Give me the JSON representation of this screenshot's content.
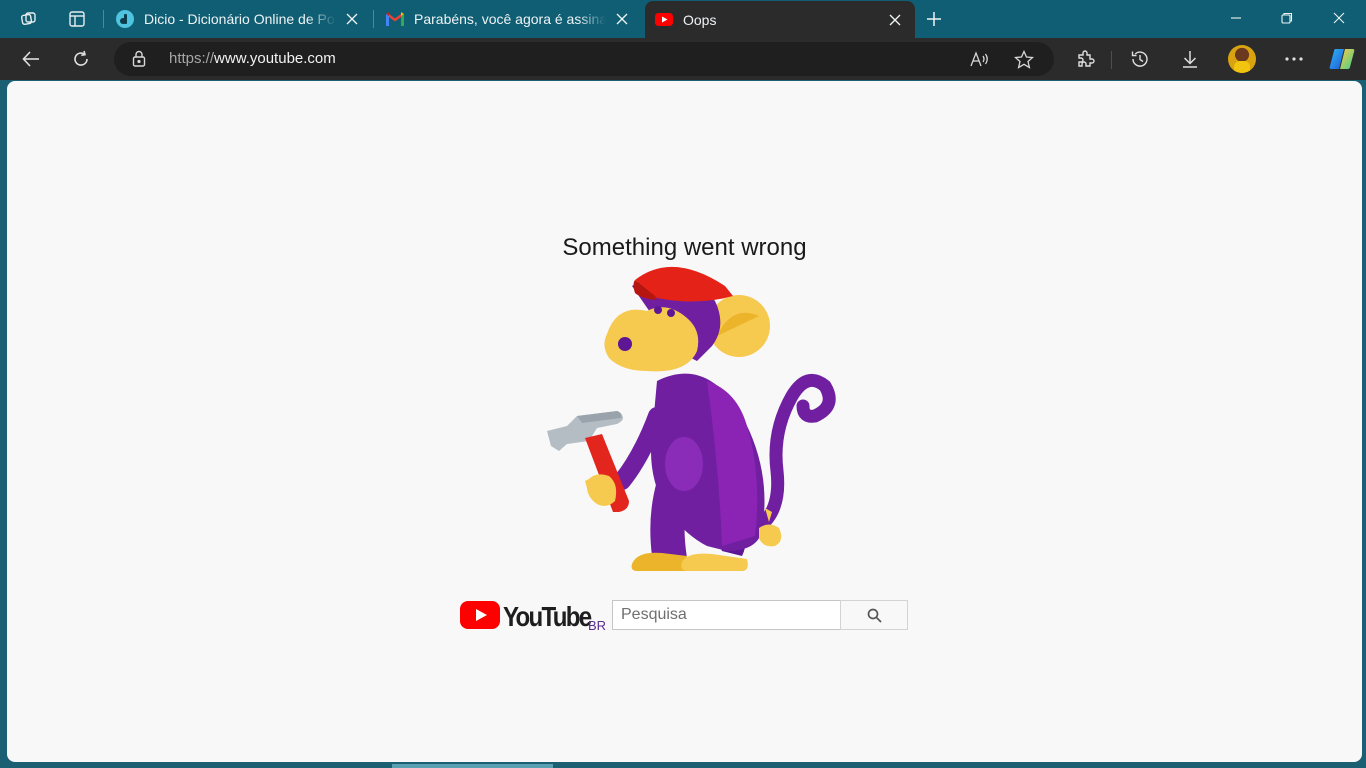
{
  "browser": {
    "tabs": [
      {
        "title": "Dicio - Dicionário Online de Português",
        "favicon": "dicio-icon"
      },
      {
        "title": "Parabéns, você agora é assinante",
        "favicon": "gmail-icon"
      },
      {
        "title": "Oops",
        "favicon": "youtube-icon",
        "active": true
      }
    ],
    "address": {
      "protocol": "https://",
      "host": "www.youtube.com"
    }
  },
  "page": {
    "error_title": "Something went wrong",
    "logo_text": "YouTube",
    "region": "BR",
    "search": {
      "placeholder": "Pesquisa",
      "value": ""
    }
  },
  "colors": {
    "tabstrip": "#0f5e73",
    "toolbar": "#2b2b2b",
    "youtube_red": "#ff0000",
    "monkey_purple": "#6f1fa0",
    "monkey_face": "#f6c94f"
  }
}
